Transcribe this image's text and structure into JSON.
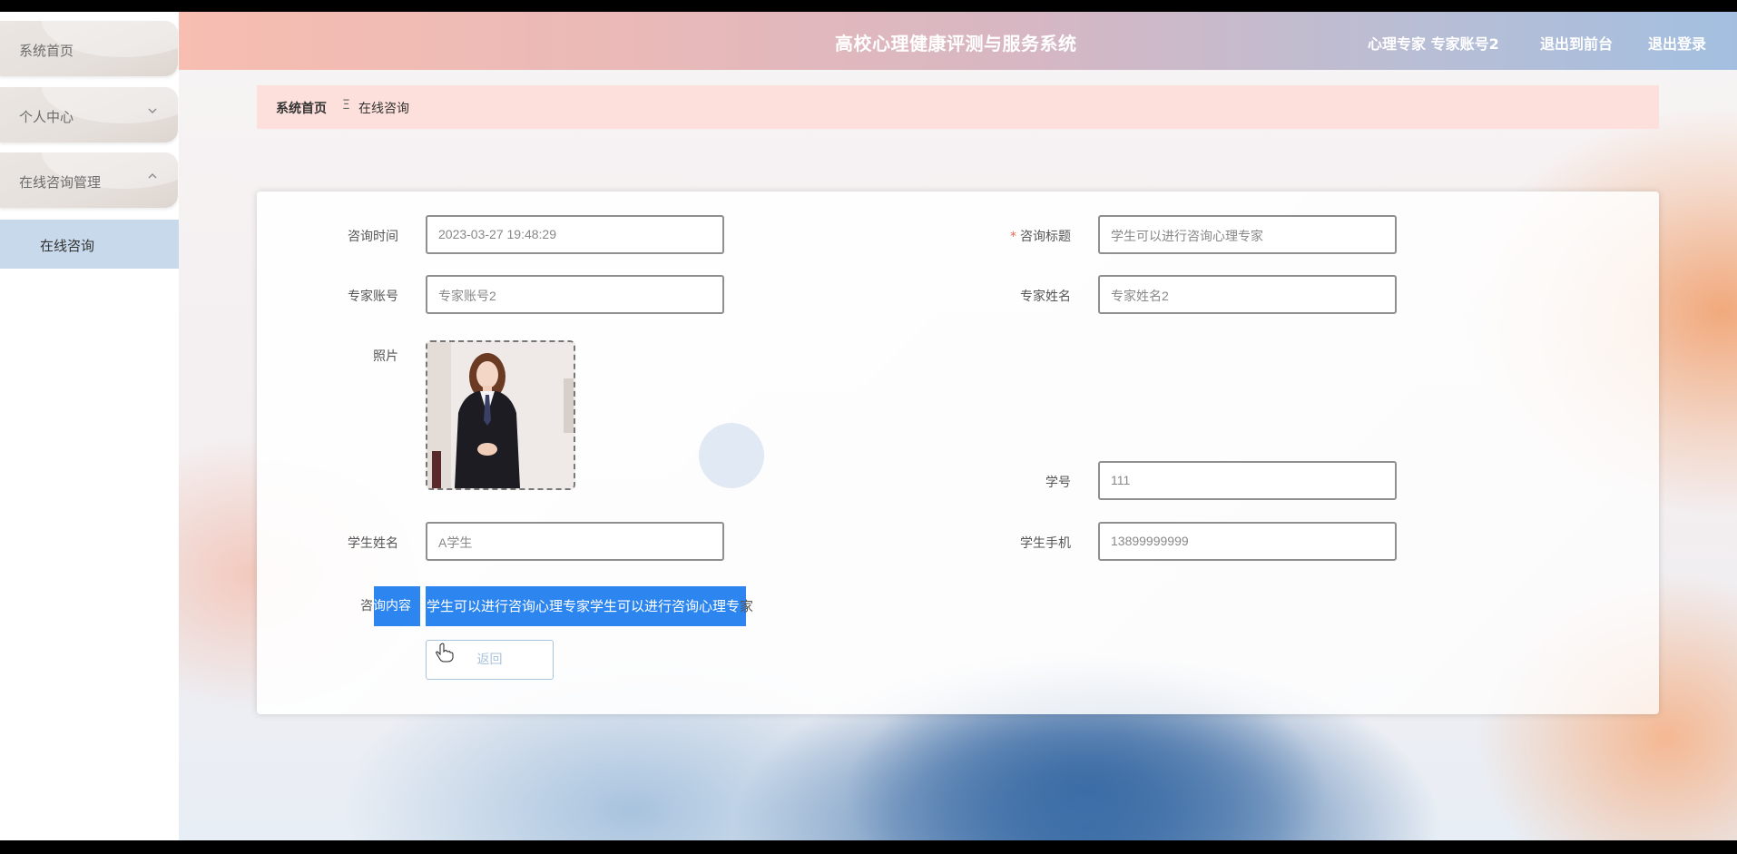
{
  "sidebar": {
    "items": [
      {
        "label": "系统首页"
      },
      {
        "label": "个人中心",
        "chevron": "chevron-down"
      },
      {
        "label": "在线咨询管理",
        "chevron": "chevron-up"
      }
    ],
    "sub_item": "在线咨询"
  },
  "header": {
    "title": "高校心理健康评测与服务系统",
    "user": "心理专家 专家账号2",
    "to_front": "退出到前台",
    "logout": "退出登录"
  },
  "breadcrumb": {
    "home": "系统首页",
    "separator": "Ξ",
    "current": "在线咨询"
  },
  "form": {
    "consult_time": {
      "label": "咨询时间",
      "value": "2023-03-27 19:48:29"
    },
    "consult_title": {
      "label": "咨询标题",
      "required_mark": "*",
      "value": "学生可以进行咨询心理专家"
    },
    "expert_account": {
      "label": "专家账号",
      "value": "专家账号2"
    },
    "expert_name": {
      "label": "专家姓名",
      "value": "专家姓名2"
    },
    "photo": {
      "label": "照片"
    },
    "student_no": {
      "label": "学号",
      "value": "111"
    },
    "student_name": {
      "label": "学生姓名",
      "value": "A学生"
    },
    "student_phone": {
      "label": "学生手机",
      "value": "13899999999"
    },
    "content": {
      "label_plain": "咨",
      "label_highlight": "询内容",
      "value_highlight": "学生可以进行咨询心理专家学生可以进行咨询心理专",
      "value_tail": "家"
    },
    "back_button": "返回"
  },
  "colors": {
    "selection": "#2d86f0",
    "sidebar_active": "#c7d9ea",
    "breadcrumb_bg": "#fde0db",
    "required": "#e86a4f"
  }
}
